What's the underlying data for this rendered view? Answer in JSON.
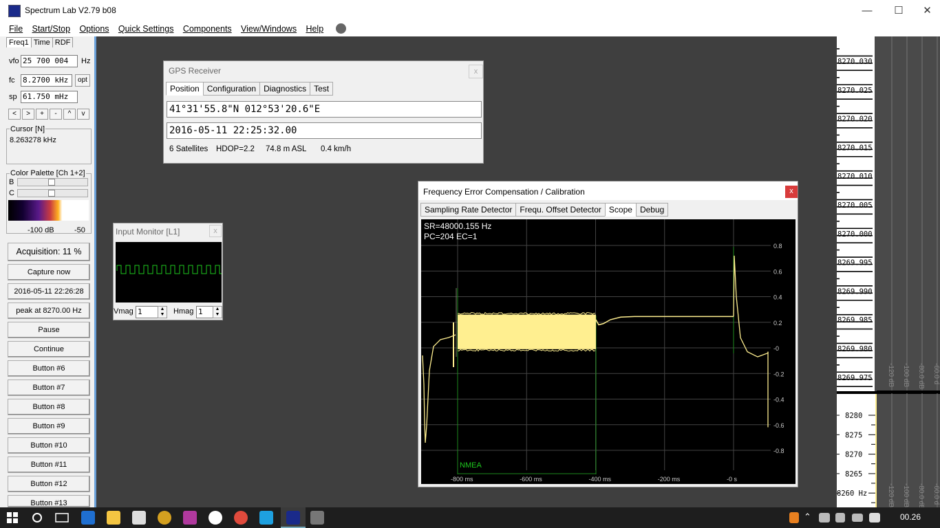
{
  "app": {
    "title": "Spectrum Lab V2.79 b08",
    "min_glyph": "—",
    "max_glyph": "☐",
    "close_glyph": "✕"
  },
  "menu": [
    "File",
    "Start/Stop",
    "Options",
    "Quick Settings",
    "Components",
    "View/Windows",
    "Help"
  ],
  "left_panel": {
    "tabs": [
      "Freq1",
      "Time",
      "RDF"
    ],
    "vfo_label": "vfo",
    "vfo_value": "25 700 004",
    "vfo_unit": "Hz",
    "fc_label": "fc",
    "fc_value": "8.2700 kHz",
    "opt_label": "opt",
    "sp_label": "sp",
    "sp_value": "61.750 mHz",
    "nav_buttons": [
      "<",
      ">",
      "+",
      "-",
      "^",
      "v"
    ],
    "cursor_title": "Cursor [N]",
    "cursor_value": "8.263278 kHz",
    "palette_title": "Color Palette [Ch 1+2]",
    "b_label": "B",
    "c_label": "C",
    "palette_left_label": "-100 dB",
    "palette_right_label": "-50",
    "buttons": [
      "Acquisition: 11 %",
      "Capture now",
      "2016-05-11 22:26:28",
      "peak at 8270.00 Hz",
      "Pause",
      "Continue",
      "Button #6",
      "Button #7",
      "Button #8",
      "Button #9",
      "Button #10",
      "Button #11",
      "Button #12",
      "Button #13"
    ]
  },
  "gps": {
    "title": "GPS Receiver",
    "close": "x",
    "tabs": [
      "Position",
      "Configuration",
      "Diagnostics",
      "Test"
    ],
    "position": "41°31'55.8\"N 012°53'20.6\"E",
    "datetime": "2016-05-11 22:25:32.00",
    "satellites": "6 Satellites",
    "hdop": "HDOP=2.2",
    "altitude": "74.8 m ASL",
    "speed": "0.4 km/h"
  },
  "input_monitor": {
    "title": "Input Monitor [L1]",
    "close": "x",
    "vmag_label": "Vmag",
    "vmag_value": "1",
    "hmag_label": "Hmag",
    "hmag_value": "1",
    "trace_color": "#1ec81e"
  },
  "freq_err": {
    "title": "Frequency Error Compensation /  Calibration",
    "close": "x",
    "tabs": [
      "Sampling Rate Detector",
      "Frequ. Offset Detector",
      "Scope",
      "Debug"
    ],
    "sr_text": "SR=48000.155 Hz",
    "pc_text": "PC=204 EC=1",
    "nmea_label": "NMEA",
    "y_ticks": [
      "0.8",
      "0.6",
      "0.4",
      "0.2",
      "-0",
      "-0.2",
      "-0.4",
      "-0.6",
      "-0.8"
    ],
    "x_ticks": [
      "-800 ms",
      "-600 ms",
      "-400 ms",
      "-200 ms",
      "-0 s"
    ],
    "trace_color": "#ffef90"
  },
  "spectrum": {
    "freq_labels": [
      "8270.030",
      "8270.025",
      "8270.020",
      "8270.015",
      "8270.010",
      "8270.005",
      "8270.000",
      "8269.995",
      "8269.990",
      "8269.985",
      "8269.980",
      "8269.975"
    ],
    "db_labels": [
      "-120 dB",
      "-100 dB",
      "-80.0 dB",
      "-60.0 d"
    ],
    "hz_labels": [
      "8280",
      "8275",
      "8270",
      "8265",
      "8260 Hz"
    ]
  },
  "taskbar": {
    "time": "00.26"
  }
}
